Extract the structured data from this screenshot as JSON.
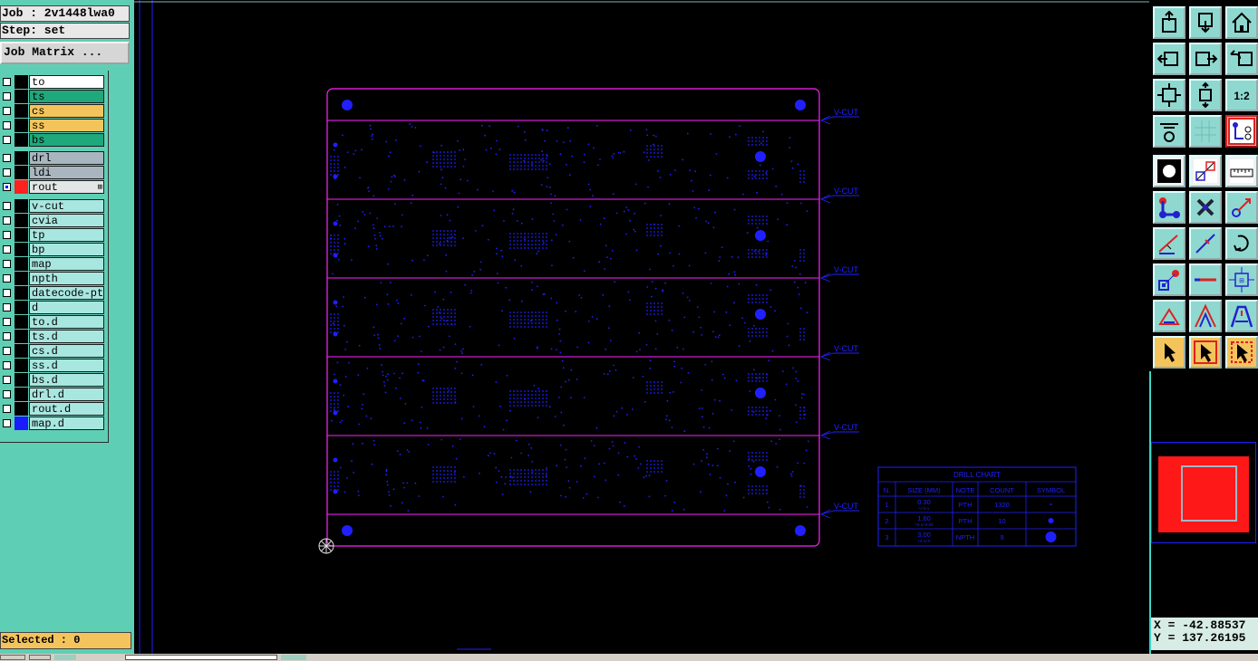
{
  "header": {
    "job": "Job : 2v1448lwa0",
    "step": "Step: set",
    "job_matrix": "Job Matrix ..."
  },
  "layers_board": [
    {
      "name": "to",
      "color": "#ffffff"
    },
    {
      "name": "ts",
      "color": "#1fa87c"
    },
    {
      "name": "cs",
      "color": "#f4c45c"
    },
    {
      "name": "ss",
      "color": "#f4c45c"
    },
    {
      "name": "bs",
      "color": "#1fa87c"
    }
  ],
  "layers_drill": [
    {
      "name": "drl",
      "color": "#a9b6c0"
    },
    {
      "name": "ldi",
      "color": "#a9b6c0"
    },
    {
      "name": "rout",
      "color": "#e3e6e6",
      "swatch": "#ff2020",
      "active": true,
      "marker": "⊞"
    }
  ],
  "layers_misc": [
    {
      "name": "v-cut"
    },
    {
      "name": "cvia"
    },
    {
      "name": "tp"
    },
    {
      "name": "bp"
    },
    {
      "name": "map"
    },
    {
      "name": "npth"
    },
    {
      "name": "datecode-pto"
    },
    {
      "name": "d"
    },
    {
      "name": "to.d"
    },
    {
      "name": "ts.d"
    },
    {
      "name": "cs.d"
    },
    {
      "name": "ss.d"
    },
    {
      "name": "bs.d"
    },
    {
      "name": "drl.d"
    },
    {
      "name": "rout.d"
    },
    {
      "name": "map.d",
      "swatch": "#1a1aff"
    }
  ],
  "selected": "Selected : 0",
  "vcut_label": "V-CUT",
  "drill_chart": {
    "title": "DRILL CHART",
    "headers": [
      "N.",
      "SIZE (MM)",
      "NOTE",
      "COUNT",
      "SYMBOL"
    ],
    "rows": [
      {
        "n": "1",
        "size": "0.30",
        "tol": "+/-0.1",
        "note": "PTH",
        "count": "1320"
      },
      {
        "n": "2",
        "size": "1.60",
        "tol": "+0.1/-0.05",
        "note": "PTH",
        "count": "10"
      },
      {
        "n": "3",
        "size": "3.00",
        "tol": "+0.1/-0",
        "note": "NPTH",
        "count": "9"
      }
    ]
  },
  "toolbar_icons": [
    "zoom-top-icon",
    "zoom-bottom-icon",
    "home-icon",
    "pan-left-icon",
    "pan-right-icon",
    "undo-view-icon",
    "fit-screen-icon",
    "fit-profile-icon",
    "scale-1-2-icon",
    "settings-icon",
    "grid-icon",
    "snap-icon",
    "fill-mode-icon",
    "outline-mode-icon",
    "measure-ruler-icon",
    "connect-icon",
    "delete-icon",
    "move-icon",
    "line-draw-icon",
    "line-edit-icon",
    "rotate-icon",
    "pad-icon",
    "line-icon",
    "resize-icon",
    "polygon-icon",
    "triangle-icon",
    "arc-icon",
    "select-arrow-icon",
    "select-box-icon",
    "select-region-icon"
  ],
  "coords": {
    "x": "X = -42.88537",
    "y": "Y = 137.26195"
  },
  "colors": {
    "panel": "#5ecfb4",
    "profile": "#ff22ff",
    "features": "#2020ff",
    "toolbar_button": "#8fd8d0"
  }
}
